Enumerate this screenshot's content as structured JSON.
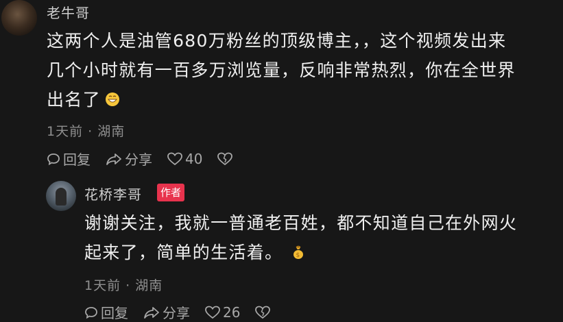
{
  "comments": [
    {
      "username": "老牛哥",
      "text_lines": [
        "这两个人是油管680万粉丝的顶级博主，，这个视频发出来",
        "几个小时就有一百多万浏览量，反响非常热烈，你在全世界",
        "出名了"
      ],
      "emoji": "grinning-face-emoji",
      "meta": "1天前 · 湖南",
      "reply_label": "回复",
      "share_label": "分享",
      "like_count": "40"
    },
    {
      "username": "花桥李哥",
      "badge": "作者",
      "text_lines": [
        "谢谢关注，我就一普通老百姓，都不知道自己在外网火",
        "起来了，简单的生活着。"
      ],
      "emoji": "money-bag-emoji",
      "meta": "1天前 · 湖南",
      "reply_label": "回复",
      "share_label": "分享",
      "like_count": "26"
    }
  ],
  "colors": {
    "background": "#171717",
    "author_badge": "#e8334d"
  }
}
